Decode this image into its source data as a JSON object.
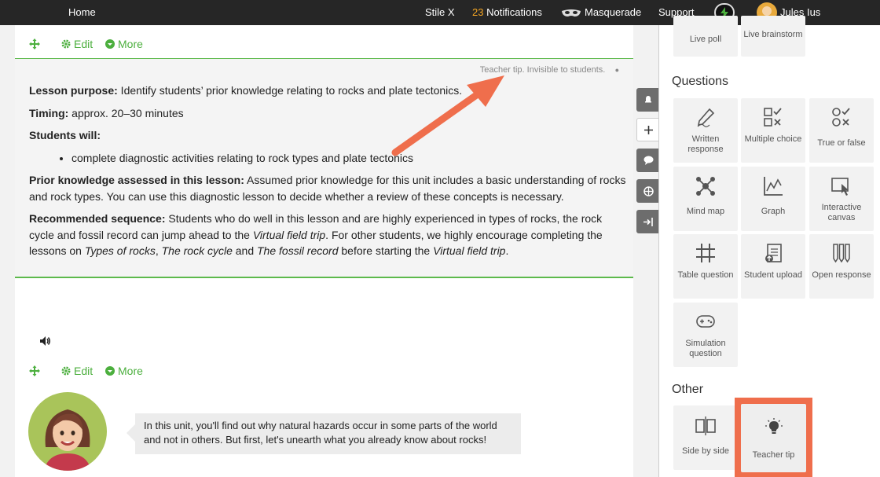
{
  "topbar": {
    "home": "Home",
    "stile_x": "Stile X",
    "notification_count": "23",
    "notifications": "Notifications",
    "masquerade": "Masquerade",
    "support": "Support",
    "user_name": "Jules Ius"
  },
  "card1": {
    "edit": "Edit",
    "more": "More",
    "tip_label": "Teacher tip. Invisible to students.",
    "purpose_label": "Lesson purpose:",
    "purpose_text": " Identify students’ prior knowledge relating to rocks and plate tectonics.",
    "timing_label": "Timing:",
    "timing_text": " approx. 20–30 minutes",
    "students_will_label": "Students will:",
    "students_will_item": "complete diagnostic activities relating to rock types and plate tectonics",
    "prior_label": "Prior knowledge assessed in this lesson:",
    "prior_text": " Assumed prior knowledge for this unit includes a basic understanding of rocks and rock types. You can use this diagnostic lesson to decide whether a review of these concepts is necessary.",
    "seq_label": "Recommended sequence:",
    "seq_text_1": " Students who do well in this lesson and are highly experienced in types of rocks, the rock cycle and fossil record can jump ahead to the ",
    "seq_em_1": "Virtual field trip",
    "seq_text_2": ". For other students, we highly encourage completing the lessons on ",
    "seq_em_2": "Types of rocks",
    "seq_text_3": ", ",
    "seq_em_3": "The rock cycle",
    "seq_text_4": " and ",
    "seq_em_4": "The fossil record",
    "seq_text_5": " before starting the ",
    "seq_em_5": "Virtual field trip",
    "seq_text_6": "."
  },
  "card2": {
    "edit": "Edit",
    "more": "More",
    "bubble_text": "In this unit, you'll find out why natural hazards occur in some parts of the world and not in others. But first, let's unearth what you already know about rocks!"
  },
  "panel": {
    "top_tiles": [
      "Live poll",
      "Live brainstorm"
    ],
    "questions_heading": "Questions",
    "question_tiles": [
      {
        "label": "Written response",
        "icon": "pencil-icon"
      },
      {
        "label": "Multiple choice",
        "icon": "multiple-choice-icon"
      },
      {
        "label": "True or false",
        "icon": "true-false-icon"
      },
      {
        "label": "Mind map",
        "icon": "mind-map-icon"
      },
      {
        "label": "Graph",
        "icon": "graph-icon"
      },
      {
        "label": "Interactive canvas",
        "icon": "canvas-icon"
      },
      {
        "label": "Table question",
        "icon": "table-icon"
      },
      {
        "label": "Student upload",
        "icon": "upload-icon"
      },
      {
        "label": "Open response",
        "icon": "open-response-icon"
      },
      {
        "label": "Simulation question",
        "icon": "gamepad-icon"
      }
    ],
    "other_heading": "Other",
    "other_tiles": [
      {
        "label": "Side by side",
        "icon": "side-by-side-icon"
      },
      {
        "label": "Teacher tip",
        "icon": "lightbulb-icon"
      }
    ]
  },
  "colors": {
    "accent_green": "#4caf3e",
    "highlight_orange": "#ef6e4c",
    "notification_orange": "#f5a623"
  }
}
